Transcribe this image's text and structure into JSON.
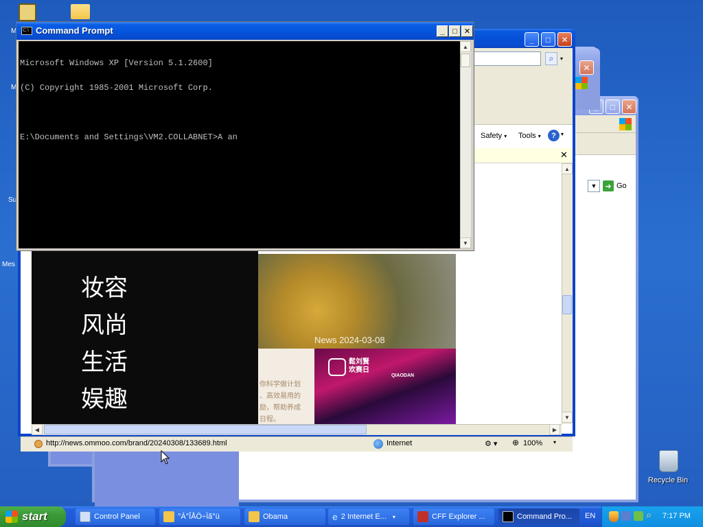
{
  "cmd": {
    "title": "Command Prompt",
    "lines": [
      "Microsoft Windows XP [Version 5.1.2600]",
      "(C) Copyright 1985-2001 Microsoft Corp.",
      "",
      "E:\\Documents and Settings\\VM2.COLLABNET>A an"
    ]
  },
  "ie": {
    "toolbar_safety": "Safety",
    "toolbar_tools": "Tools",
    "status_url": "http://news.ommoo.com/brand/20240308/133689.html",
    "zone": "Internet",
    "zoom": "100%",
    "page": {
      "nav": [
        "妆容",
        "风尚",
        "生活",
        "娱趣"
      ],
      "news_label": "News 2024-03-08",
      "snippet_lines": [
        "你科学做计划",
        "、高效易用的",
        "励，帮助养成",
        "日程。"
      ],
      "ad_text": [
        "鬆刘賢",
        "欢赛日"
      ],
      "ad_brand": "QIAODAN"
    }
  },
  "browser3": {
    "go_label": "Go"
  },
  "desktop": {
    "left_labels": [
      "M",
      "M",
      "Su",
      "Mes"
    ],
    "recycle_bin": "Recycle Bin"
  },
  "taskbar": {
    "start": "start",
    "tasks": [
      {
        "label": "Control Panel"
      },
      {
        "label": "°Á°ÎÅÖ÷Ìã°ü"
      },
      {
        "label": "Obama"
      },
      {
        "label": "2 Internet E..."
      },
      {
        "label": "CFF Explorer ..."
      },
      {
        "label": "Command Pro..."
      }
    ],
    "lang": "EN",
    "clock": "7:17 PM"
  }
}
